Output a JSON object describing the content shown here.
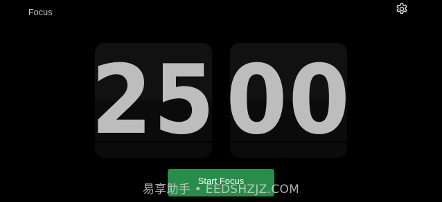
{
  "header": {
    "title": "Focus",
    "settings_icon": "gear-icon"
  },
  "timer": {
    "minutes": "25",
    "seconds": "00"
  },
  "actions": {
    "start_label": "Start Focus"
  },
  "watermark": {
    "text": "易享助手 • EEDSHZJZ.COM"
  },
  "colors": {
    "background": "#000000",
    "card": "#111111",
    "digit": "#bdbdbd",
    "accent": "#2a8c4a"
  }
}
